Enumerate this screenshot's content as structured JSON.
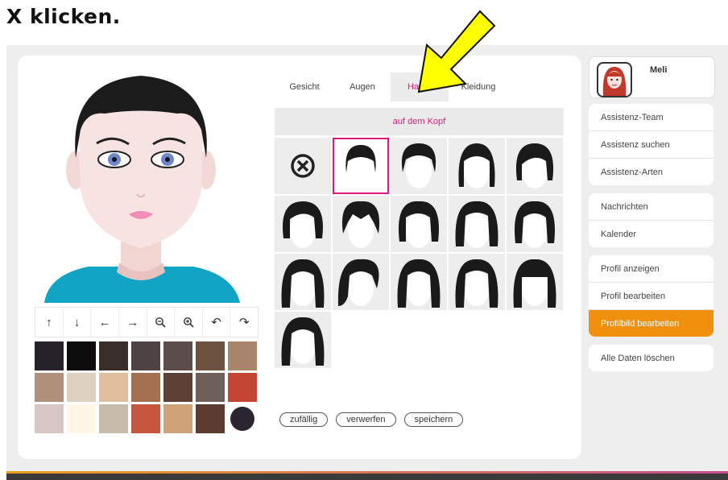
{
  "caption": "X klicken.",
  "tabs": [
    {
      "label": "Gesicht"
    },
    {
      "label": "Augen"
    },
    {
      "label": "Haare"
    },
    {
      "label": "Kleidung"
    }
  ],
  "active_tab": "Haare",
  "section_label": "auf dem Kopf",
  "tools": [
    {
      "icon": "arrow-up-icon",
      "glyph": "↑"
    },
    {
      "icon": "arrow-down-icon",
      "glyph": "↓"
    },
    {
      "icon": "arrow-left-icon",
      "glyph": "←"
    },
    {
      "icon": "arrow-right-icon",
      "glyph": "→"
    },
    {
      "icon": "zoom-out-icon",
      "glyph": "🔍"
    },
    {
      "icon": "zoom-in-icon",
      "glyph": "🔍"
    },
    {
      "icon": "undo-icon",
      "glyph": "↶"
    },
    {
      "icon": "redo-icon",
      "glyph": "↷"
    }
  ],
  "swatches": [
    "#26222a",
    "#0c0c0c",
    "#3a2f28",
    "#4e4342",
    "#5c4c4a",
    "#6d5141",
    "#a88469",
    "#b1917a",
    "#ddd0bf",
    "#e0bf9f",
    "#a57050",
    "#5d4035",
    "#6e5f5b",
    "#c44534",
    "#d8c6c6",
    "#fff6e5",
    "#c7bcaa",
    "#c7563f",
    "#cda377",
    "#5c3b31",
    "#2b2530"
  ],
  "actions": {
    "random": "zufällig",
    "discard": "verwerfen",
    "save": "speichern"
  },
  "profile": {
    "name": "Meli"
  },
  "menu_groups": [
    [
      "Assistenz-Team",
      "Assistenz suchen",
      "Assistenz-Arten"
    ],
    [
      "Nachrichten",
      "Kalender"
    ],
    [
      "Profil anzeigen",
      "Profil bearbeiten",
      "Profilbild bearbeiten"
    ],
    [
      "Alle Daten löschen"
    ]
  ],
  "active_menu": "Profilbild bearbeiten",
  "colors": {
    "accent_pink": "#e0197e",
    "accent_orange": "#f0900c",
    "arrow_yellow": "#ffff00"
  }
}
